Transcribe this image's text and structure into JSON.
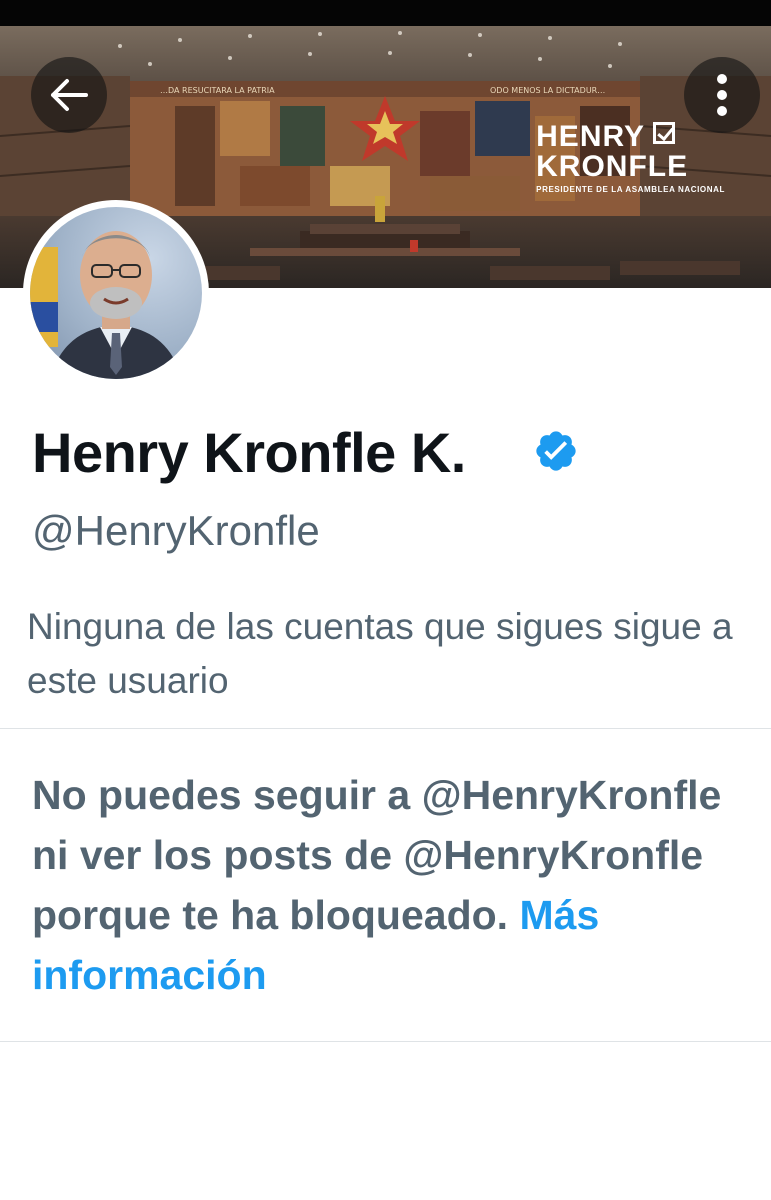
{
  "banner": {
    "mural_text_left": "…DA RESUCITARA LA PATRIA",
    "mural_text_right": "ODO MENOS LA DICTADUR…",
    "brand_name": "HENRY",
    "brand_name_line2": "KRONFLE",
    "brand_subtitle": "PRESIDENTE DE LA ASAMBLEA NACIONAL"
  },
  "toolbar": {
    "back_icon": "arrow-left-icon",
    "more_icon": "more-vertical-icon"
  },
  "profile": {
    "display_name": "Henry Kronfle K.",
    "verified_icon": "verified-badge-icon",
    "handle": "@HenryKronfle",
    "follow_context": "Ninguna de las cuentas que sigues sigue a este usuario"
  },
  "blocked": {
    "message": "No puedes seguir a @HenryKronfle ni ver los posts de @HenryKronfle porque te ha bloqueado.",
    "link": "Más información"
  },
  "colors": {
    "text_primary": "#0f1419",
    "text_secondary": "#536471",
    "accent": "#1d9bf0",
    "divider": "#dfe3e6"
  }
}
